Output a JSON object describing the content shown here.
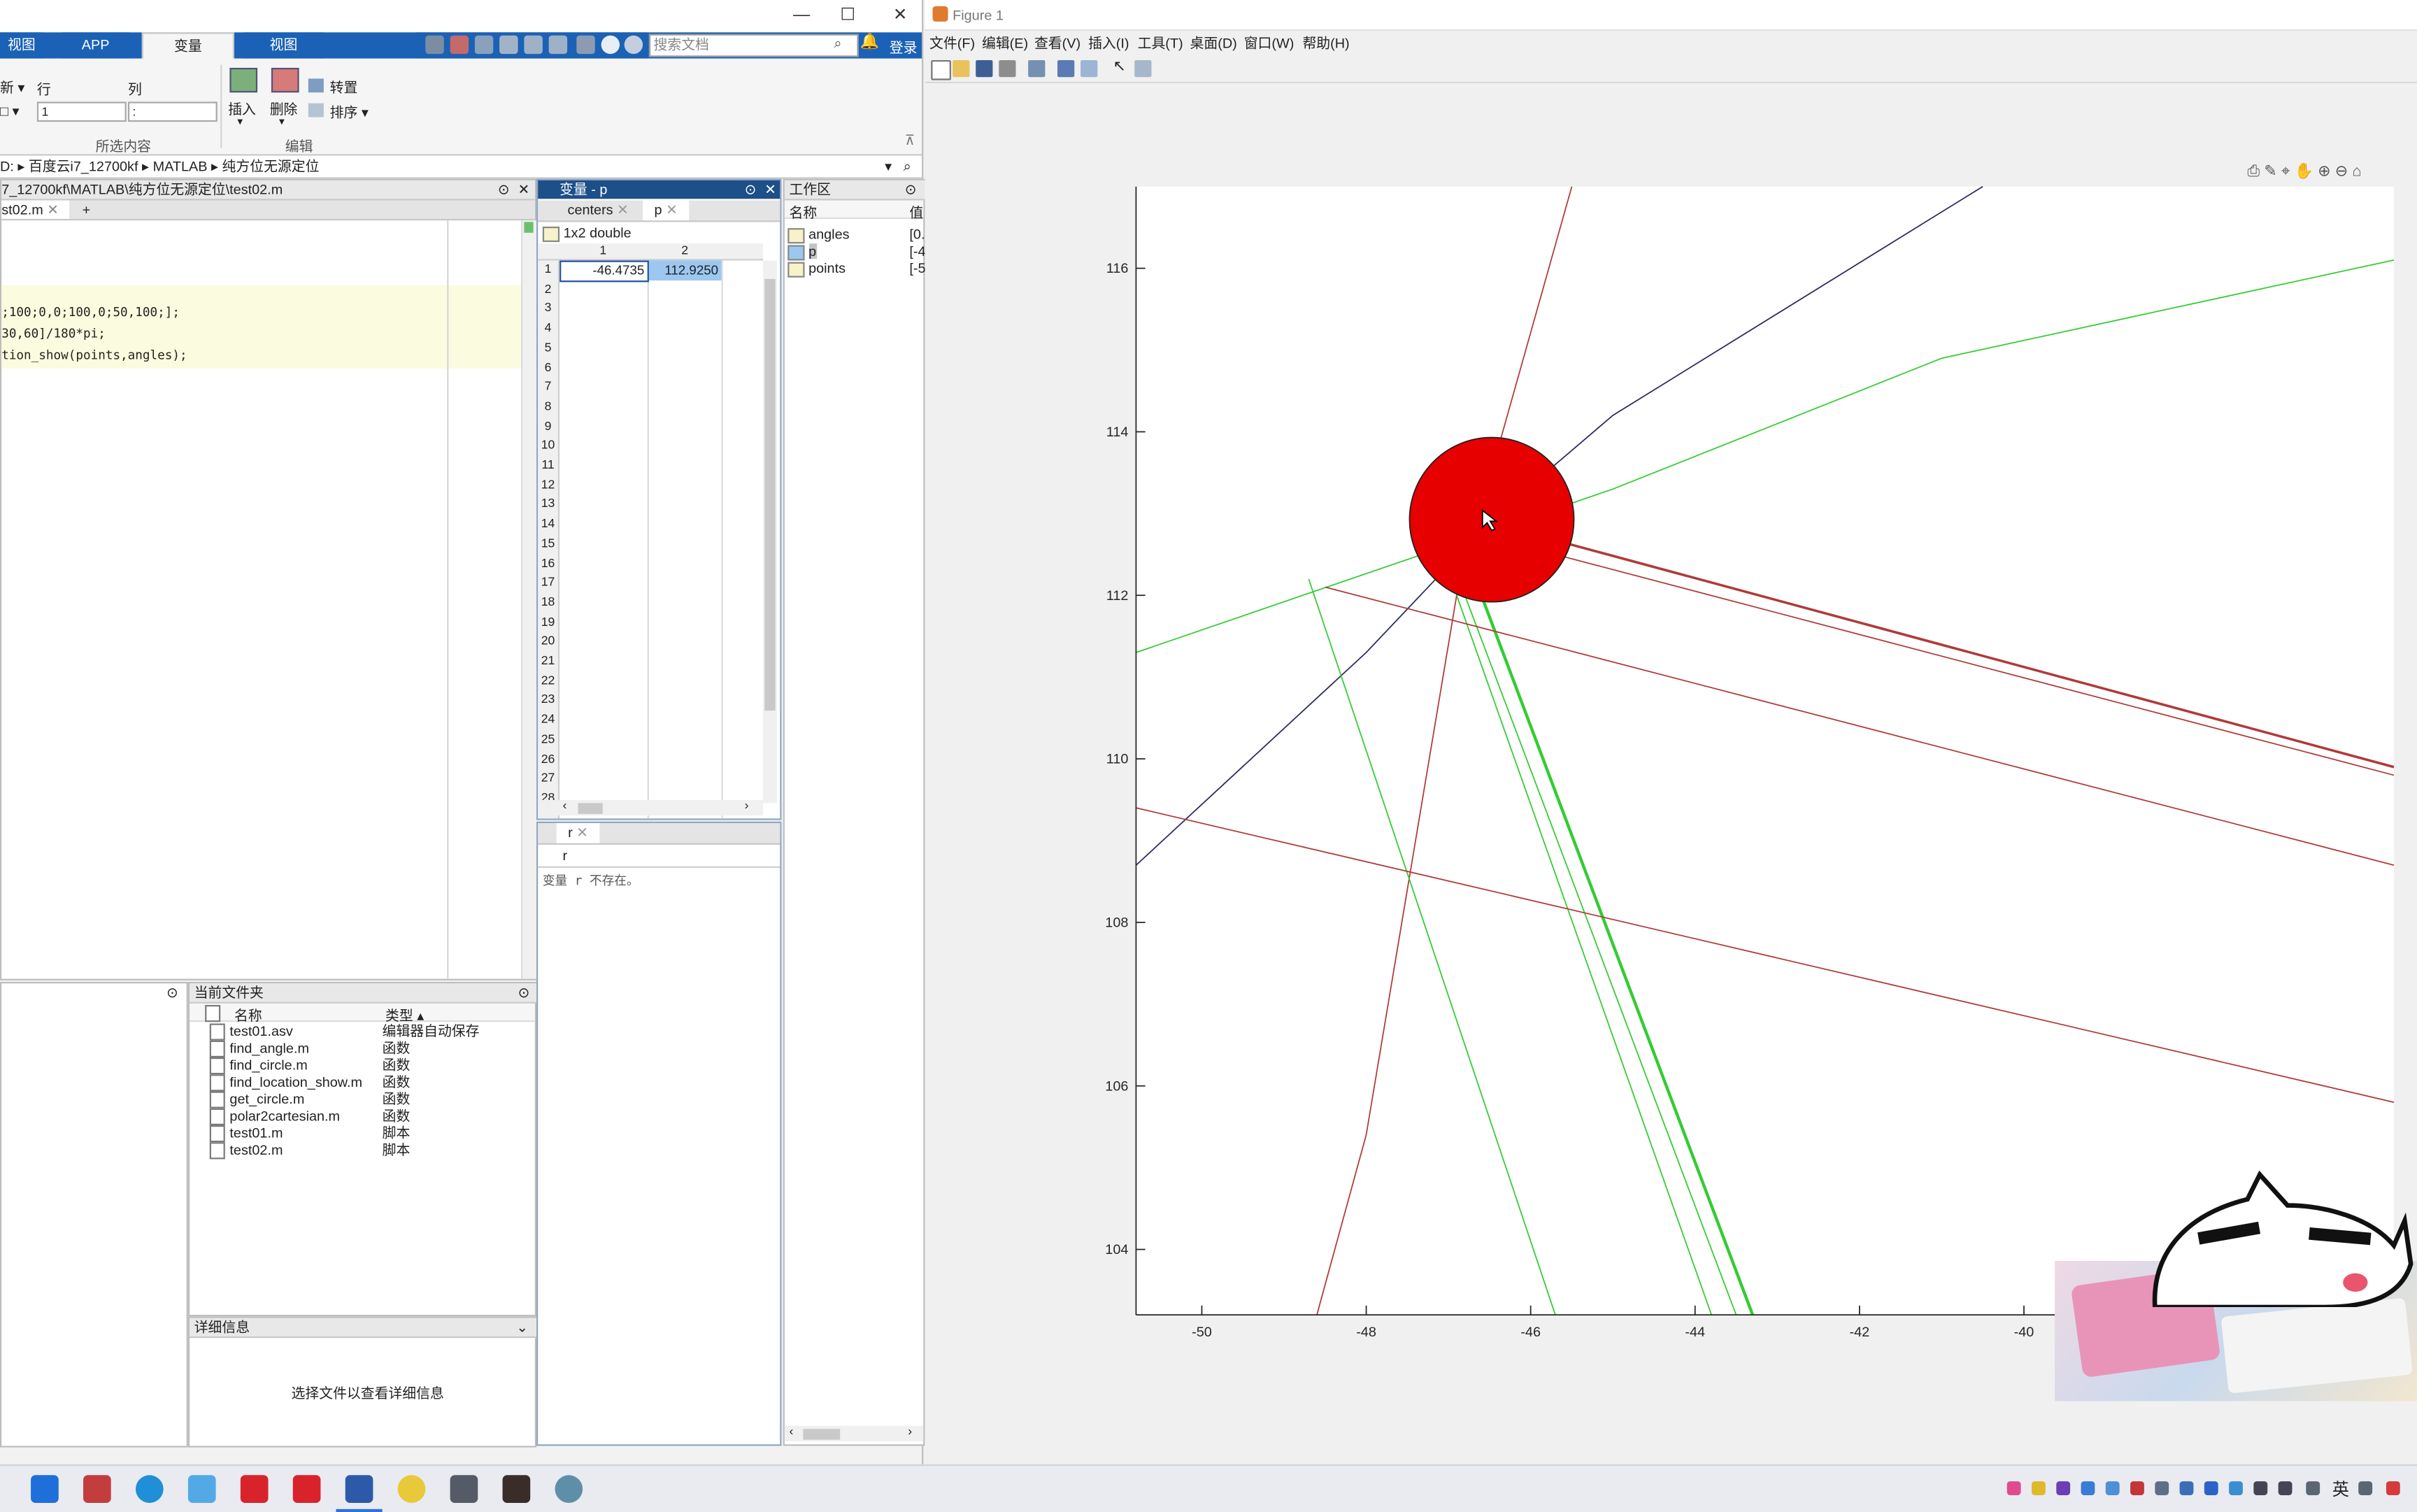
{
  "matlab": {
    "ribbon_tabs": [
      "视图",
      "APP",
      "变量",
      "视图"
    ],
    "search_placeholder": "搜索文档",
    "login": "登录",
    "window_controls": {
      "minimize": "—",
      "maximize": "☐",
      "close": "✕"
    },
    "ribbon": {
      "new_dropdown": "新",
      "row_label": "行",
      "col_label": "列",
      "row_value": "1",
      "col_value": ":",
      "insert_label": "插入",
      "delete_label": "删除",
      "transpose_label": "转置",
      "sort_label": "排序",
      "section_selection": "所选内容",
      "section_edit": "编辑"
    },
    "address": {
      "prefix": "D:",
      "crumbs": [
        "百度云i7_12700kf",
        "MATLAB",
        "纯方位无源定位"
      ]
    },
    "editor": {
      "path": "7_12700kf\\MATLAB\\纯方位无源定位\\test02.m",
      "tab_label": "st02.m",
      "add_tab": "+",
      "code_lines": [
        ";100;0,0;100,0;50,100;];",
        "30,60]/180*pi;",
        "tion_show(points,angles);"
      ]
    },
    "current_folder": {
      "title": "当前文件夹",
      "col_name": "名称",
      "col_type": "类型 ▴",
      "files": [
        {
          "name": "test01.asv",
          "type": "编辑器自动保存"
        },
        {
          "name": "find_angle.m",
          "type": "函数"
        },
        {
          "name": "find_circle.m",
          "type": "函数"
        },
        {
          "name": "find_location_show.m",
          "type": "函数"
        },
        {
          "name": "get_circle.m",
          "type": "函数"
        },
        {
          "name": "polar2cartesian.m",
          "type": "函数"
        },
        {
          "name": "test01.m",
          "type": "脚本"
        },
        {
          "name": "test02.m",
          "type": "脚本"
        }
      ]
    },
    "details": {
      "title": "详细信息",
      "message": "选择文件以查看详细信息"
    },
    "variable_editor": {
      "title": "变量 - p",
      "tabs": [
        "centers",
        "p"
      ],
      "size_label": "1x2 double",
      "col_headers": [
        "1",
        "2"
      ],
      "row_numbers": [
        "1",
        "2",
        "3",
        "4",
        "5",
        "6",
        "7",
        "8",
        "9",
        "10",
        "11",
        "12",
        "13",
        "14",
        "15",
        "16",
        "17",
        "18",
        "19",
        "20",
        "21",
        "22",
        "23",
        "24",
        "25",
        "26",
        "27",
        "28"
      ],
      "values": [
        "-46.4735",
        "112.9250"
      ]
    },
    "r_panel": {
      "tab": "r",
      "name": "r",
      "message": "变量 r 不存在。"
    },
    "workspace": {
      "title": "工作区",
      "col_name": "名称",
      "col_value": "值",
      "vars": [
        {
          "name": "angles",
          "value": "[0."
        },
        {
          "name": "p",
          "value": "[-4"
        },
        {
          "name": "points",
          "value": "[-5"
        }
      ]
    }
  },
  "figure": {
    "title": "Figure 1",
    "menu": [
      "文件(F)",
      "编辑(E)",
      "查看(V)",
      "插入(I)",
      "工具(T)",
      "桌面(D)",
      "窗口(W)",
      "帮助(H)"
    ]
  },
  "chart_data": {
    "type": "line",
    "title": "",
    "xlabel": "",
    "ylabel": "",
    "xlim": [
      -50.8,
      -35.5
    ],
    "ylim": [
      103.2,
      117
    ],
    "x_ticks": [
      "-50",
      "-48",
      "-46",
      "-44",
      "-42",
      "-40"
    ],
    "x_tick_values": [
      -50,
      -48,
      -46,
      -44,
      -42,
      -40
    ],
    "y_ticks": [
      "104",
      "106",
      "108",
      "110",
      "112",
      "114",
      "116"
    ],
    "y_tick_values": [
      104,
      106,
      108,
      110,
      112,
      114,
      116
    ],
    "grid": false,
    "colors": {
      "dark_red": "#b03a3a",
      "green": "#33cc33",
      "navy": "#2a2a5e",
      "marker_fill": "#e60000"
    },
    "series": [
      {
        "color": "dark_red",
        "width": 0.8,
        "points": [
          [
            -48.6,
            103.2
          ],
          [
            -48.0,
            105.4
          ],
          [
            -46.9,
            112.0
          ],
          [
            -45.5,
            117.0
          ]
        ]
      },
      {
        "color": "navy",
        "width": 0.8,
        "points": [
          [
            -50.8,
            108.7
          ],
          [
            -48.0,
            111.3
          ],
          [
            -46.4,
            113.0
          ],
          [
            -45.0,
            114.2
          ],
          [
            -40.5,
            117.0
          ]
        ]
      },
      {
        "color": "green",
        "width": 0.8,
        "points": [
          [
            -50.8,
            111.3
          ],
          [
            -45.0,
            113.3
          ],
          [
            -41.0,
            114.9
          ],
          [
            -35.5,
            116.1
          ]
        ]
      },
      {
        "color": "green",
        "width": 0.8,
        "points": [
          [
            -48.7,
            112.2
          ],
          [
            -45.7,
            103.2
          ]
        ]
      },
      {
        "color": "green",
        "width": 0.8,
        "points": [
          [
            -46.9,
            112.0
          ],
          [
            -43.8,
            103.2
          ]
        ]
      },
      {
        "color": "green",
        "width": 0.8,
        "points": [
          [
            -46.8,
            112.0
          ],
          [
            -43.5,
            103.2
          ]
        ]
      },
      {
        "color": "green",
        "width": 2.0,
        "points": [
          [
            -46.6,
            112.0
          ],
          [
            -43.3,
            103.2
          ]
        ]
      },
      {
        "color": "dark_red",
        "width": 0.8,
        "points": [
          [
            -50.8,
            109.4
          ],
          [
            -35.5,
            105.8
          ]
        ]
      },
      {
        "color": "dark_red",
        "width": 0.8,
        "points": [
          [
            -48.5,
            112.1
          ],
          [
            -35.5,
            108.7
          ]
        ]
      },
      {
        "color": "dark_red",
        "width": 0.8,
        "points": [
          [
            -45.7,
            112.5
          ],
          [
            -35.5,
            109.8
          ]
        ]
      },
      {
        "color": "dark_red",
        "width": 1.6,
        "points": [
          [
            -45.8,
            112.7
          ],
          [
            -35.5,
            109.9
          ]
        ]
      }
    ],
    "marker": {
      "x": -46.4735,
      "y": 112.925,
      "radius": 1.0,
      "color": "marker_fill"
    }
  },
  "taskbar": {
    "ime": "英",
    "tray_icon_count": 14
  }
}
